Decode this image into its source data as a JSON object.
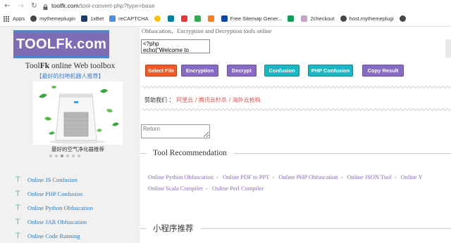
{
  "browser": {
    "url_host": "toolfk.com",
    "url_path": "/tool-convert-php?type=base",
    "bookmarks": [
      {
        "label": "Apps",
        "icon": "apps-grid-icon",
        "color": "#5f6368"
      },
      {
        "label": "mythemeplugin",
        "icon": "wordpress-icon",
        "color": "#464646"
      },
      {
        "label": "1xBet",
        "icon": "1xbet-icon",
        "color": "#1a3d6d"
      },
      {
        "label": "reCAPTCHA",
        "icon": "recaptcha-icon",
        "color": "#4a90d9"
      },
      {
        "label": "",
        "icon": "emoji-icon",
        "color": "#f4c20d"
      },
      {
        "label": "",
        "icon": "bing-icon",
        "color": "#00809d"
      },
      {
        "label": "",
        "icon": "red-square-icon",
        "color": "#e53935"
      },
      {
        "label": "",
        "icon": "green-f-icon",
        "color": "#34a853"
      },
      {
        "label": "",
        "icon": "cloud-icon",
        "color": "#f48120"
      },
      {
        "label": "Free Sitemap Gener...",
        "icon": "sitemap-x-icon",
        "color": "#0d47a1"
      },
      {
        "label": "",
        "icon": "green-t-icon",
        "color": "#0f9d58"
      },
      {
        "label": "2checkout",
        "icon": "2checkout-icon",
        "color": "#c8a2c8"
      },
      {
        "label": "host.mythemeplugi",
        "icon": "wordpress-icon",
        "color": "#464646"
      },
      {
        "label": "",
        "icon": "wordpress-icon",
        "color": "#464646"
      }
    ]
  },
  "sidebar": {
    "logo_text": "TOOLFk.com",
    "site_name_pre": "Tool",
    "site_name_bold": "Fk",
    "site_name_post": " online Web toolbox",
    "sub_link": "【最好的扫地机器人推荐】",
    "banner_caption": "最好的空气净化器推荐",
    "menu": [
      {
        "icon": "T",
        "label": "Online JS Confusion"
      },
      {
        "label": "Online PHP Confusion",
        "icon": "T"
      },
      {
        "label": "Online Python Obfuscation",
        "icon": "T"
      },
      {
        "label": "Online JAR Obfuscation",
        "icon": "T"
      },
      {
        "label": "Online Code Running",
        "icon": "T"
      }
    ]
  },
  "main": {
    "tagline": "Obfuscation、Encryption and Decryption tools online",
    "code_input": "<?php\necho(\"Welcome to",
    "buttons": [
      {
        "label": "Select File",
        "color": "#f05a28"
      },
      {
        "label": "Encryption",
        "color": "#8a6bc4"
      },
      {
        "label": "Decrypt",
        "color": "#8a6bc4"
      },
      {
        "label": "Confusion",
        "color": "#1bb6c1"
      },
      {
        "label": "PHP Confusion",
        "color": "#1bb6c1"
      },
      {
        "label": "Copy Result",
        "color": "#8a6bc4"
      }
    ],
    "sponsor_label": "赞助我们 ：",
    "sponsors": [
      "阿里云",
      "腾讯云秒杀",
      "海外云抢购"
    ],
    "return_placeholder": "Return",
    "tool_recommendation_title": "Tool Recommendation",
    "recommendations_row1": [
      "Online Python Obfuscation",
      "Online PDF to PPT",
      "Online PHP Obfuscation",
      "Online JSON Tool",
      "Online Y"
    ],
    "recommendations_row2": [
      "Online Scala Compiler",
      "Online Perl Compiler"
    ],
    "mini_program_title": "小程序推荐"
  }
}
